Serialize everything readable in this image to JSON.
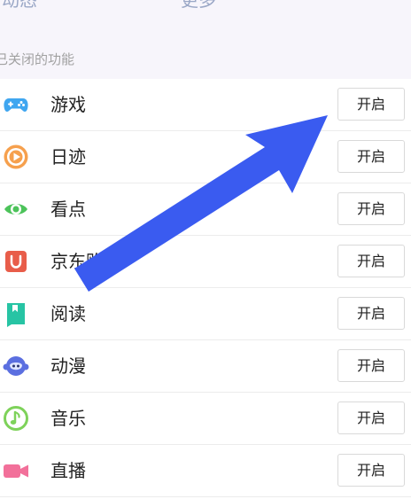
{
  "top_tabs": [
    "动态",
    "更多"
  ],
  "section": {
    "title": "已关闭的功能"
  },
  "items": [
    {
      "label": "游戏",
      "button": "开启",
      "icon": "gamepad-icon",
      "color": "#3fa6f0"
    },
    {
      "label": "日迹",
      "button": "开启",
      "icon": "play-circle-icon",
      "color": "#f6a04d"
    },
    {
      "label": "看点",
      "button": "开启",
      "icon": "eye-icon",
      "color": "#4cc35a"
    },
    {
      "label": "京东购物",
      "button": "开启",
      "icon": "shopping-bag-icon",
      "color": "#e85d4a"
    },
    {
      "label": "阅读",
      "button": "开启",
      "icon": "book-icon",
      "color": "#27c4a4"
    },
    {
      "label": "动漫",
      "button": "开启",
      "icon": "cartoon-face-icon",
      "color": "#5b6fe0"
    },
    {
      "label": "音乐",
      "button": "开启",
      "icon": "music-note-icon",
      "color": "#7ed25a"
    },
    {
      "label": "直播",
      "button": "开启",
      "icon": "video-camera-icon",
      "color": "#f2709a"
    }
  ],
  "annotation": {
    "arrow_color": "#3a5bf0"
  }
}
